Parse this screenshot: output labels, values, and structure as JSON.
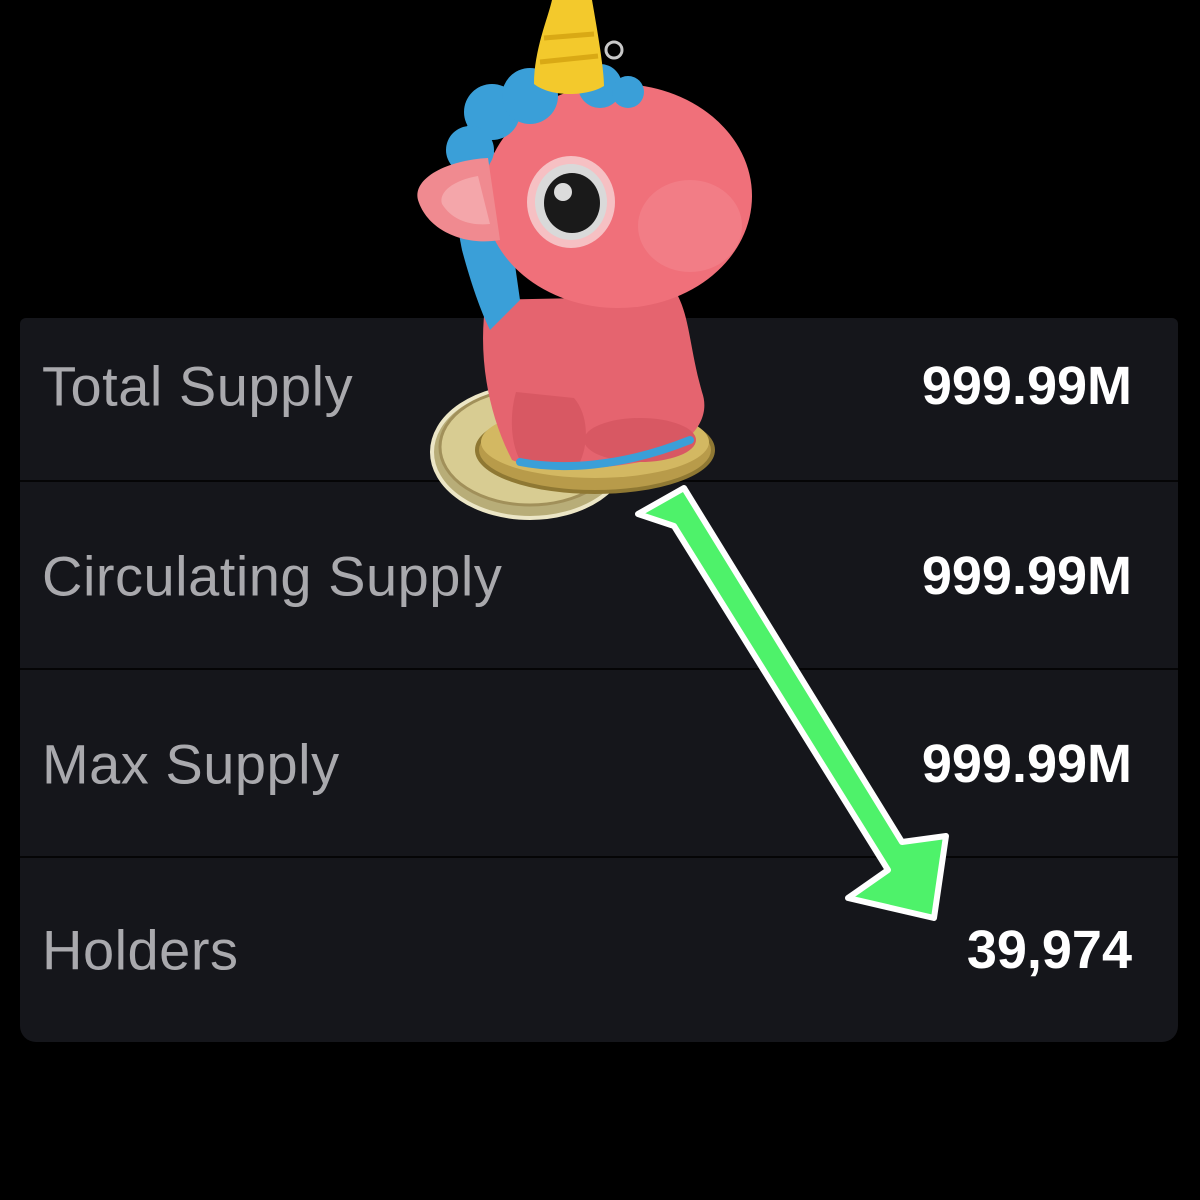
{
  "token_stats": {
    "rows": [
      {
        "label": "Total Supply",
        "value": "999.99M"
      },
      {
        "label": "Circulating Supply",
        "value": "999.99M"
      },
      {
        "label": "Max Supply",
        "value": "999.99M"
      },
      {
        "label": "Holders",
        "value": "39,974"
      }
    ]
  },
  "overlay": {
    "mascot": "pink-unicorn-figurine-on-coins",
    "arrow_direction": "down-right",
    "arrow_color": "#4ef26a",
    "unicorn_body_color": "#f0707a",
    "unicorn_mane_color": "#3a9fd8",
    "unicorn_horn_color": "#f3c92c",
    "coin_color": "#d8cc92"
  },
  "colors": {
    "background": "#000000",
    "panel": "#15161b",
    "label_text": "#a9a9ad",
    "value_text": "#ffffff"
  }
}
